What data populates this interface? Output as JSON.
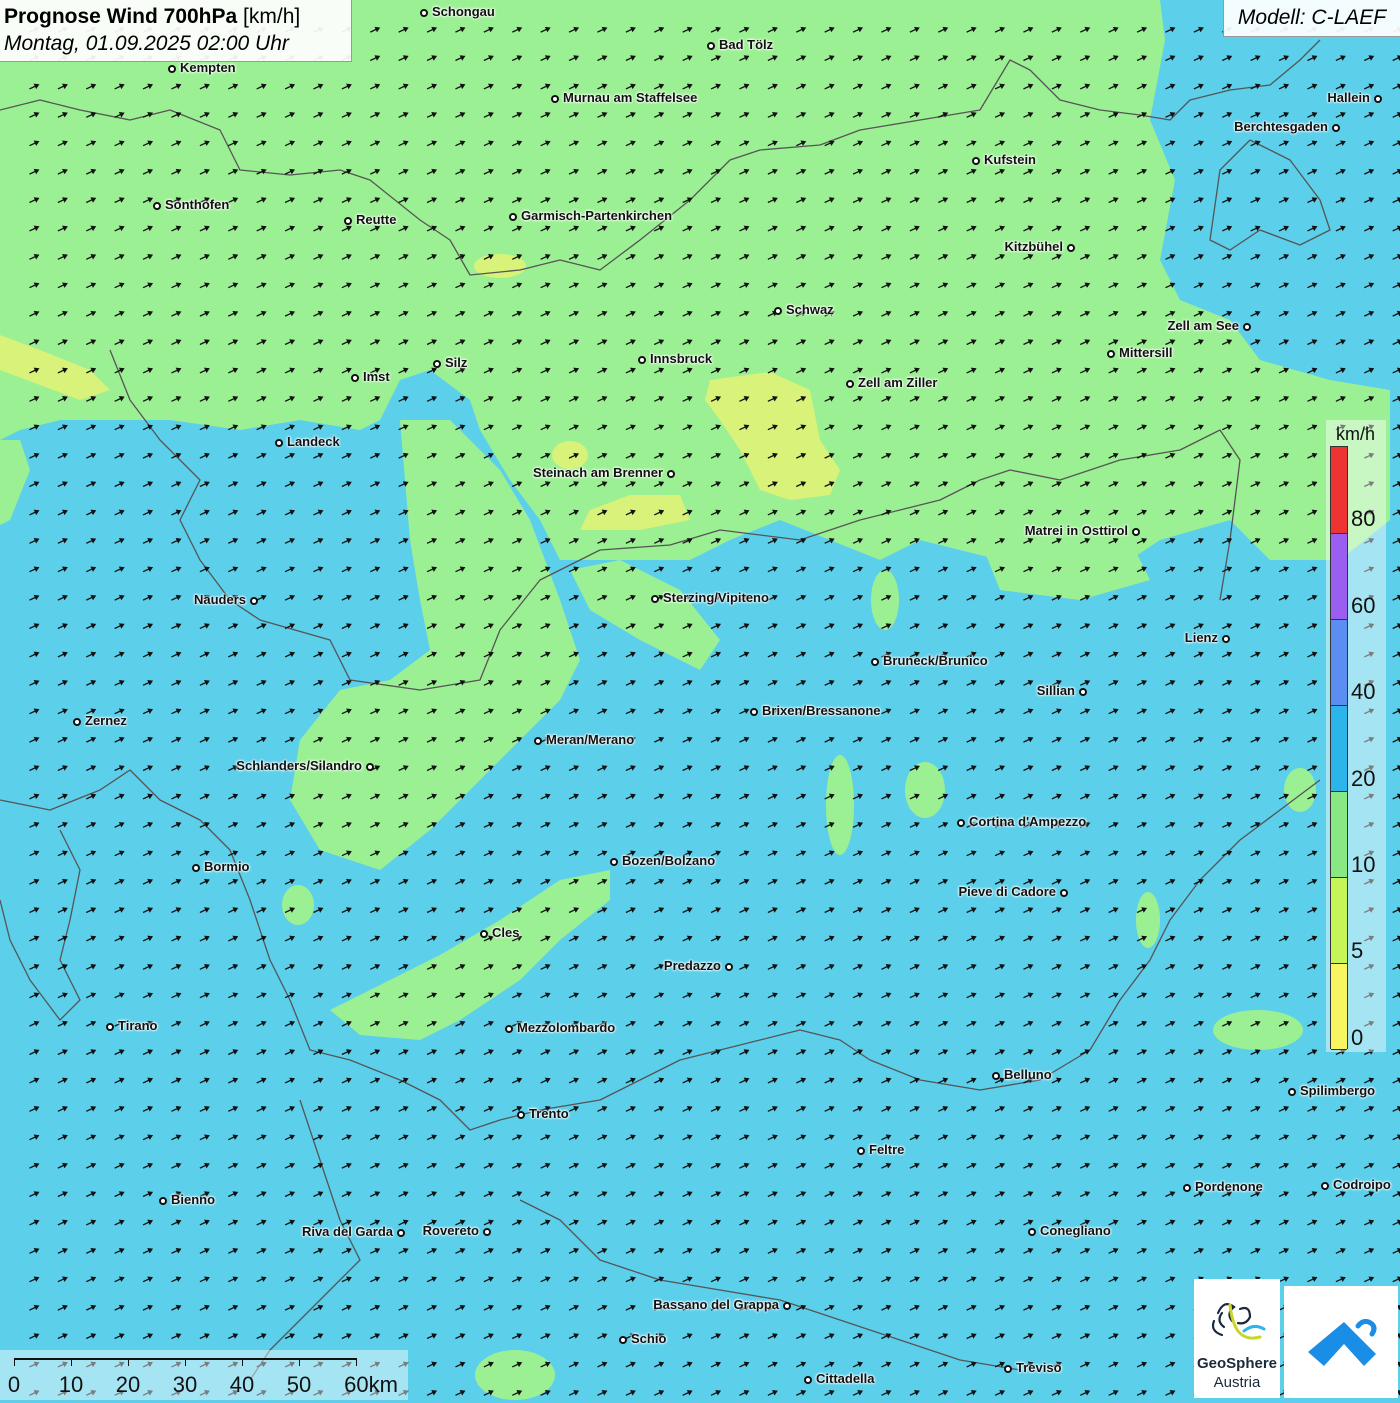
{
  "header": {
    "title_bold": "Prognose Wind 700hPa",
    "title_unit": "[km/h]",
    "subtitle": "Montag, 01.09.2025 02:00 Uhr"
  },
  "model": {
    "label": "Modell: C-LAEF"
  },
  "legend": {
    "unit": "km/h",
    "ticks": [
      "80",
      "60",
      "40",
      "20",
      "10",
      "5",
      "0"
    ],
    "colors": [
      "#ee3333",
      "#9a5ef0",
      "#5b8ef0",
      "#2bb5ea",
      "#87e884",
      "#c6f55a",
      "#f7f560"
    ]
  },
  "scale": {
    "labels": [
      "0",
      "10",
      "20",
      "30",
      "40",
      "50",
      "60km"
    ]
  },
  "logos": {
    "geosphere_name": "GeoSphere",
    "geosphere_sub": "Austria",
    "app_icon": "wind-app-icon"
  },
  "colors": {
    "wind_0_10_green": "#9cf094",
    "wind_10_20_blue": "#5ccfea",
    "wind_5_10_yellow": "#d8f27a",
    "arrow": "#111111",
    "borders": "#555555"
  },
  "cities": [
    {
      "name": "Schongau"
    },
    {
      "name": "Bad Tölz"
    },
    {
      "name": "Kempten"
    },
    {
      "name": "Murnau am Staffelsee"
    },
    {
      "name": "Hallein"
    },
    {
      "name": "Berchtesgaden"
    },
    {
      "name": "Kufstein"
    },
    {
      "name": "Sonthofen"
    },
    {
      "name": "Reutte"
    },
    {
      "name": "Garmisch-Partenkirchen"
    },
    {
      "name": "Kitzbühel"
    },
    {
      "name": "Schwaz"
    },
    {
      "name": "Zell am See"
    },
    {
      "name": "Mittersill"
    },
    {
      "name": "Imst"
    },
    {
      "name": "Silz"
    },
    {
      "name": "Innsbruck"
    },
    {
      "name": "Zell am Ziller"
    },
    {
      "name": "Landeck"
    },
    {
      "name": "Steinach am Brenner"
    },
    {
      "name": "Matrei in Osttirol"
    },
    {
      "name": "Nauders"
    },
    {
      "name": "Sterzing/Vipiteno"
    },
    {
      "name": "Lienz"
    },
    {
      "name": "Bruneck/Brunico"
    },
    {
      "name": "Sillian"
    },
    {
      "name": "Brixen/Bressanone"
    },
    {
      "name": "Zernez"
    },
    {
      "name": "Meran/Merano"
    },
    {
      "name": "Schlanders/Silandro"
    },
    {
      "name": "Cortina d'Ampezzo"
    },
    {
      "name": "Bormio"
    },
    {
      "name": "Bozen/Bolzano"
    },
    {
      "name": "Pieve di Cadore"
    },
    {
      "name": "Cles"
    },
    {
      "name": "Predazzo"
    },
    {
      "name": "Tirano"
    },
    {
      "name": "Mezzolombardo"
    },
    {
      "name": "Belluno"
    },
    {
      "name": "Spilimbergo"
    },
    {
      "name": "Trento"
    },
    {
      "name": "Feltre"
    },
    {
      "name": "Pordenone"
    },
    {
      "name": "Codroipo"
    },
    {
      "name": "Bienno"
    },
    {
      "name": "Riva del Garda"
    },
    {
      "name": "Rovereto"
    },
    {
      "name": "Conegliano"
    },
    {
      "name": "Bassano del Grappa"
    },
    {
      "name": "Schio"
    },
    {
      "name": "Treviso"
    },
    {
      "name": "Cittadella"
    }
  ]
}
